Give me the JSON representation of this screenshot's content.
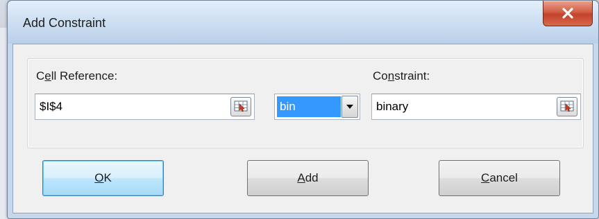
{
  "dialog": {
    "title": "Add Constraint",
    "close_icon": "close-x-icon"
  },
  "cell_reference": {
    "label_before": "C",
    "label_accel": "e",
    "label_after": "ll Reference:",
    "value": "$I$4",
    "picker_icon": "range-select-icon"
  },
  "operator": {
    "selected": "bin",
    "dropdown_icon": "chevron-down-icon"
  },
  "constraint": {
    "label_before": "Co",
    "label_accel": "n",
    "label_after": "straint:",
    "value": "binary",
    "picker_icon": "range-select-icon"
  },
  "buttons": {
    "ok_accel": "O",
    "ok_rest": "K",
    "add_accel": "A",
    "add_rest": "dd",
    "cancel_accel": "C",
    "cancel_rest": "ancel"
  },
  "colors": {
    "selection": "#3399ff",
    "close_button": "#c3422b",
    "default_button_border": "#3c7fb1"
  }
}
